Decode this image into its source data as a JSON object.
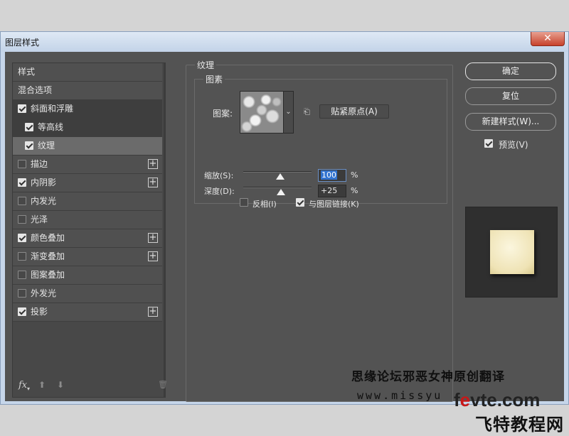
{
  "window": {
    "title": "图层样式",
    "close_glyph": "✕"
  },
  "left_panel": {
    "items": [
      {
        "label": "样式",
        "checkbox": false,
        "checked": false,
        "plus": false,
        "indent": false,
        "state": "normal"
      },
      {
        "label": "混合选项",
        "checkbox": false,
        "checked": false,
        "plus": false,
        "indent": false,
        "state": "normal"
      },
      {
        "label": "斜面和浮雕",
        "checkbox": true,
        "checked": true,
        "plus": false,
        "indent": false,
        "state": "dark"
      },
      {
        "label": "等高线",
        "checkbox": true,
        "checked": true,
        "plus": false,
        "indent": true,
        "state": "dark"
      },
      {
        "label": "纹理",
        "checkbox": true,
        "checked": true,
        "plus": false,
        "indent": true,
        "state": "selected"
      },
      {
        "label": "描边",
        "checkbox": true,
        "checked": false,
        "plus": true,
        "indent": false,
        "state": "normal"
      },
      {
        "label": "内阴影",
        "checkbox": true,
        "checked": true,
        "plus": true,
        "indent": false,
        "state": "normal"
      },
      {
        "label": "内发光",
        "checkbox": true,
        "checked": false,
        "plus": false,
        "indent": false,
        "state": "normal"
      },
      {
        "label": "光泽",
        "checkbox": true,
        "checked": false,
        "plus": false,
        "indent": false,
        "state": "normal"
      },
      {
        "label": "颜色叠加",
        "checkbox": true,
        "checked": true,
        "plus": true,
        "indent": false,
        "state": "normal"
      },
      {
        "label": "渐变叠加",
        "checkbox": true,
        "checked": false,
        "plus": true,
        "indent": false,
        "state": "normal"
      },
      {
        "label": "图案叠加",
        "checkbox": true,
        "checked": false,
        "plus": false,
        "indent": false,
        "state": "normal"
      },
      {
        "label": "外发光",
        "checkbox": true,
        "checked": false,
        "plus": false,
        "indent": false,
        "state": "normal"
      },
      {
        "label": "投影",
        "checkbox": true,
        "checked": true,
        "plus": true,
        "indent": false,
        "state": "normal"
      }
    ],
    "footer": {
      "fx_label": "fx",
      "up_glyph": "⬆",
      "down_glyph": "⬇",
      "trash_glyph": "🗑"
    }
  },
  "texture": {
    "group_title": "纹理",
    "pattern_group_title": "图素",
    "pattern_label": "图案:",
    "snap_origin_button": "贴紧原点(A)",
    "scale_label": "缩放(S):",
    "scale_value": "100",
    "scale_unit": "%",
    "scale_level_percent": 100,
    "depth_label": "深度(D):",
    "depth_value": "+25",
    "depth_unit": "%",
    "depth_level_percent": 25,
    "invert_label": "反相(I)",
    "invert_checked": false,
    "link_label": "与图层链接(K)",
    "link_checked": true
  },
  "right_panel": {
    "ok_button": "确定",
    "reset_button": "复位",
    "new_style_button": "新建样式(W)...",
    "preview_label": "预览(V)",
    "preview_checked": true
  },
  "watermark": {
    "line1": "思缘论坛邪恶女神原创翻译",
    "line2": "www.missyu",
    "logo_en_prefix": "f",
    "logo_en_e": "e",
    "logo_en_suffix": "vte.com",
    "logo_cn": "飞特教程网"
  }
}
